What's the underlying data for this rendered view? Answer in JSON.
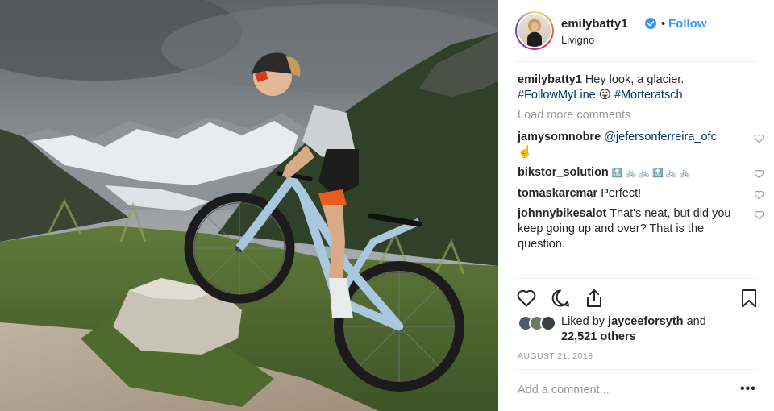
{
  "post": {
    "username": "emilybatty1",
    "follow_label": "Follow",
    "dot": "•",
    "location": "Livigno"
  },
  "caption": {
    "username": "emilybatty1",
    "text": "Hey look, a glacier.",
    "hashtag1": "#FollowMyLine",
    "emoji": "😛",
    "hashtag2": "#Morteratsch"
  },
  "load_more": "Load more comments",
  "comments": [
    {
      "user": "jamysomnobre",
      "text": "@jefersonferreira_ofc",
      "extra": "☝️"
    },
    {
      "user": "bikstor_solution",
      "text": "🔝 🚲 🚲 🔝 🚲 🚲"
    },
    {
      "user": "tomaskarcmar",
      "text": "Perfect!"
    },
    {
      "user": "johnnybikesalot",
      "text": "That's neat, but did you keep going up and over? That is the question."
    }
  ],
  "likes": {
    "prefix": "Liked by",
    "user": "jayceeforsyth",
    "and": "and",
    "count": "22,521 others"
  },
  "date": "AUGUST 21, 2018",
  "add_comment_placeholder": "Add a comment...",
  "more_label": "•••",
  "icons": [
    "heart-icon",
    "comment-icon",
    "share-icon",
    "bookmark-icon",
    "verified-badge-icon"
  ],
  "colors": {
    "link": "#3897f0",
    "hashtag": "#003569",
    "muted": "#999999"
  }
}
